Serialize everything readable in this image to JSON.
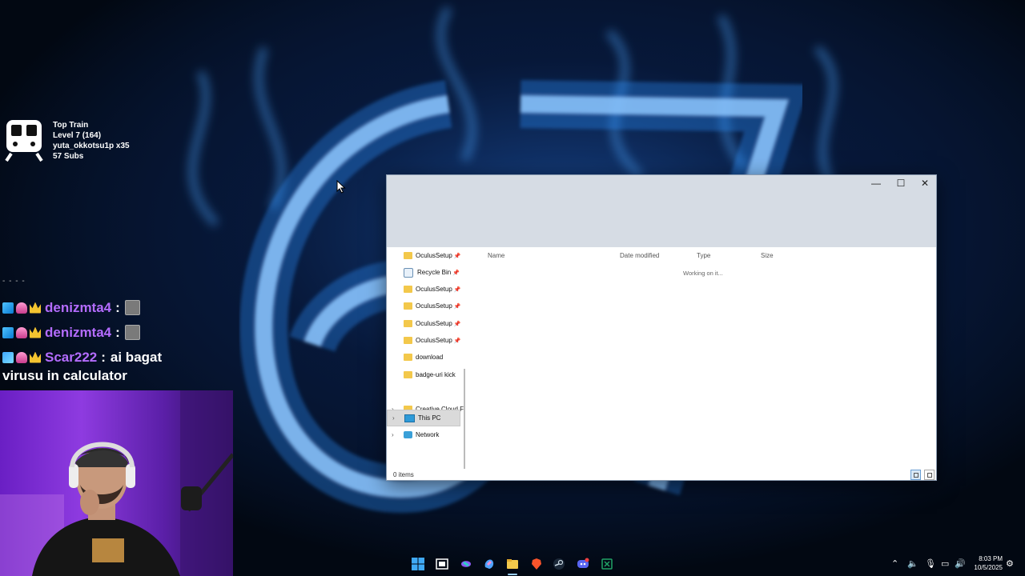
{
  "overlay": {
    "train": {
      "title": "Top Train",
      "level": "Level 7  (164)",
      "user": "yuta_okkotsu1p x35",
      "subs": "57 Subs"
    },
    "chat": {
      "separator": "- - - -",
      "messages": [
        {
          "user": "denizmta4",
          "text": ""
        },
        {
          "user": "denizmta4",
          "text": ""
        },
        {
          "user": "Scar222",
          "text": "ai bagat"
        }
      ],
      "continuation": "virusu in calculator"
    }
  },
  "explorer": {
    "controls": {
      "minimize": "—",
      "maximize": "☐",
      "close": "✕"
    },
    "nav_items": [
      {
        "label": "OculusSetup",
        "pinned": true
      },
      {
        "label": "Recycle Bin",
        "pinned": true
      },
      {
        "label": "OculusSetup",
        "pinned": true
      },
      {
        "label": "OculusSetup",
        "pinned": true
      },
      {
        "label": "OculusSetup",
        "pinned": true
      },
      {
        "label": "OculusSetup",
        "pinned": true
      },
      {
        "label": "download",
        "pinned": false
      },
      {
        "label": "badge-uri kick",
        "pinned": false
      },
      {
        "label": "Creative Cloud F",
        "pinned": false
      },
      {
        "label": "This PC",
        "pinned": false
      },
      {
        "label": "Network",
        "pinned": false
      }
    ],
    "columns": [
      "Name",
      "Date modified",
      "Type",
      "Size"
    ],
    "status_message": "Working on it...",
    "item_count": "0 items"
  },
  "taskbar": {
    "clock_time": "8:03 PM",
    "clock_date": "10/5/2025"
  },
  "colors": {
    "accent_blue": "#3ea6ff",
    "chat_username": "#b46cff"
  }
}
